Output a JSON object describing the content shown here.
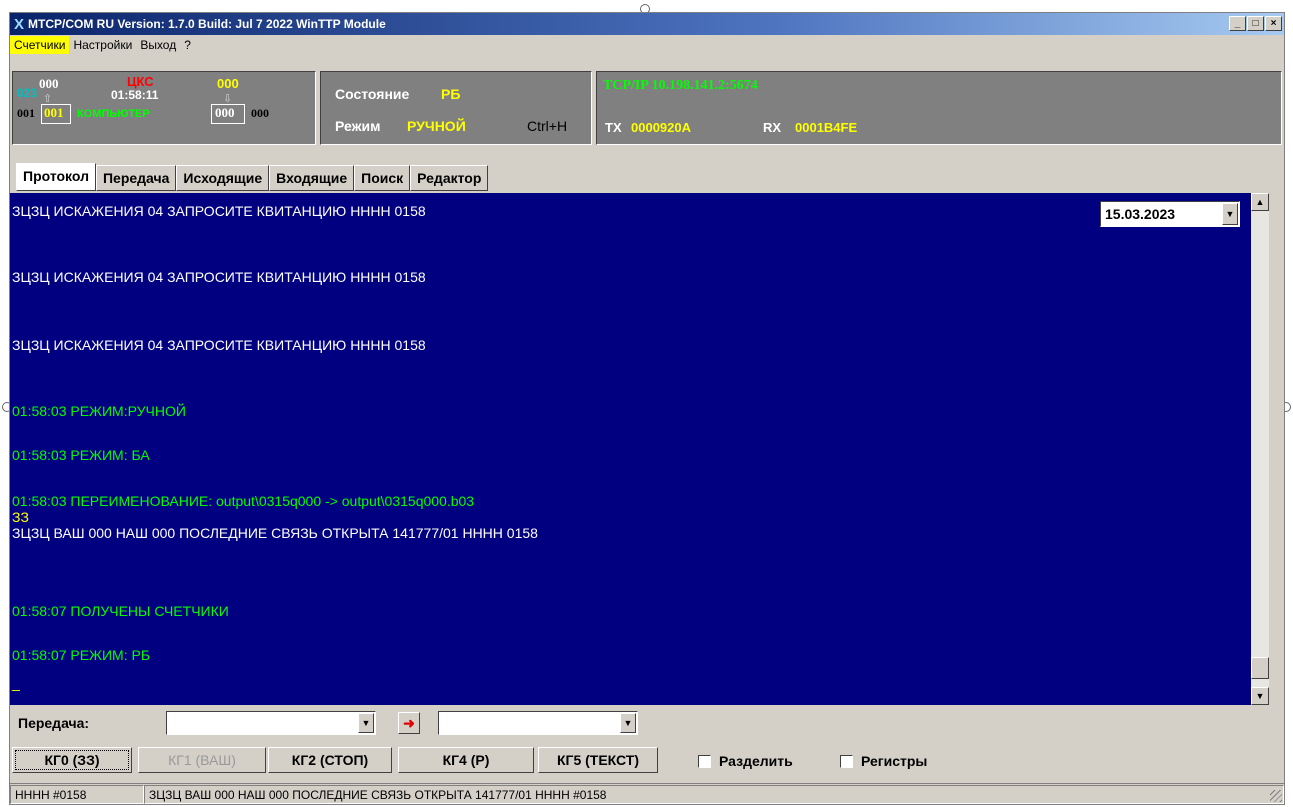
{
  "window": {
    "title": "MTCP/COM RU  Version: 1.7.0 Build: Jul  7 2022  WinTTP Module",
    "logo": "X",
    "min_btn": "_",
    "max_btn": "□",
    "close_btn": "×"
  },
  "menu": {
    "items": [
      "Счетчики",
      "Настройки",
      "Выход",
      "?"
    ],
    "active_index": 0
  },
  "panel1": {
    "top_left_num": "000",
    "left_counter": "023",
    "up_arrow": "⇧",
    "center_label": "ЦКС",
    "time": "01:58:11",
    "right_top_num": "000",
    "down_arrow": "⇩",
    "bottom_left": "001",
    "bottom_left_box": "001",
    "source_label": "КОМПЬЮТЕР",
    "bottom_right_box": "000",
    "bottom_right": "000"
  },
  "panel2": {
    "state_label": "Состояние",
    "state_value": "РБ",
    "mode_label": "Режим",
    "mode_value": "РУЧНОЙ",
    "hotkey": "Ctrl+H"
  },
  "panel3": {
    "connection": "TCP/IP 10.198.141.2:5674",
    "tx_label": "TX",
    "tx_value": "0000920A",
    "rx_label": "RX",
    "rx_value": "0001B4FE"
  },
  "tabs": [
    "Протокол",
    "Передача",
    "Исходящие",
    "Входящие",
    "Поиск",
    "Редактор"
  ],
  "active_tab": 0,
  "date_picker": {
    "value": "15.03.2023"
  },
  "log": [
    {
      "text": "ЗЦЗЦ ИСКАЖЕНИЯ 04 ЗАПРОСИТЕ КВИТАНЦИЮ НННН  0158",
      "color": "white"
    },
    {
      "text": "ЗЦЗЦ ИСКАЖЕНИЯ 04 ЗАПРОСИТЕ КВИТАНЦИЮ НННН  0158",
      "color": "white"
    },
    {
      "text": "ЗЦЗЦ ИСКАЖЕНИЯ 04 ЗАПРОСИТЕ КВИТАНЦИЮ НННН  0158",
      "color": "white"
    },
    {
      "text": "01:58:03 РЕЖИМ:РУЧНОЙ",
      "color": "green"
    },
    {
      "text": "01:58:03 РЕЖИМ: БА",
      "color": "green"
    },
    {
      "text": "01:58:03 ПЕРЕИМЕНОВАНИЕ: output\\0315q000 -> output\\0315q000.b03",
      "color": "green"
    },
    {
      "text": "ЗЗ",
      "color": "yellow"
    },
    {
      "text": "ЗЦЗЦ ВАШ 000 НАШ 000 ПОСЛЕДНИЕ СВЯЗЬ ОТКРЫТА 141777/01 НННН  0158",
      "color": "white"
    },
    {
      "text": "01:58:07 ПОЛУЧЕНЫ СЧЕТЧИКИ",
      "color": "green"
    },
    {
      "text": "01:58:07 РЕЖИМ: РБ",
      "color": "green"
    },
    {
      "text": "_",
      "color": "yellow"
    }
  ],
  "send": {
    "label": "Передача:",
    "combo1_value": "",
    "combo2_value": "",
    "arrow": "➜"
  },
  "kg_buttons": [
    {
      "label": "КГ0 (ЗЗ)",
      "state": "focused"
    },
    {
      "label": "КГ1 (ВАШ)",
      "state": "disabled"
    },
    {
      "label": "КГ2 (СТОП)",
      "state": "normal"
    },
    {
      "label": "КГ4 (Р)",
      "state": "normal"
    },
    {
      "label": "КГ5 (ТЕКСТ)",
      "state": "normal"
    }
  ],
  "checkboxes": [
    {
      "label": "Разделить",
      "checked": false
    },
    {
      "label": "Регистры",
      "checked": false
    }
  ],
  "statusbar": {
    "left": "НННН  #0158",
    "right": "ЗЦЗЦ ВАШ 000 НАШ 000 ПОСЛЕДНИЕ СВЯЗЬ ОТКРЫТА 141777/01 НННН  #0158"
  },
  "colors": {
    "log_bg": "#000080",
    "panel_bg": "#808080",
    "green": "#00ff00",
    "yellow": "#ffff00",
    "red": "#ff0000",
    "cyan": "#00c0c0"
  }
}
